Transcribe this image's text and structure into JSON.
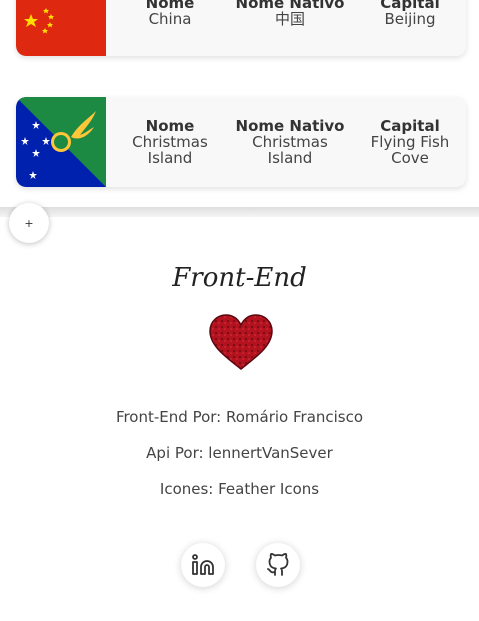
{
  "countries": [
    {
      "name_label": "Nome",
      "name": "China",
      "native_label": "Nome Nativo",
      "native": "中国",
      "capital_label": "Capital",
      "capital": "Beijing",
      "flag_icon": "china-flag",
      "flag_colors": [
        "#de2910",
        "#ffde00"
      ]
    },
    {
      "name_label": "Nome",
      "name": "Christmas Island",
      "native_label": "Nome Nativo",
      "native": "Christmas Island",
      "capital_label": "Capital",
      "capital": "Flying Fish Cove",
      "flag_icon": "christmas-island-flag",
      "flag_colors": [
        "#0021ad",
        "#1c8a42",
        "#ffc639"
      ]
    }
  ],
  "expand_button": {
    "label": "+"
  },
  "footer": {
    "title": "Front-End",
    "heart_icon": "heart-icon",
    "heart_color": "#b3121f",
    "credits": [
      "Front-End Por: Romário Francisco",
      "Api Por: lennertVanSever",
      "Icones: Feather Icons"
    ],
    "social": [
      {
        "icon": "linkedin-icon"
      },
      {
        "icon": "github-icon"
      }
    ]
  }
}
